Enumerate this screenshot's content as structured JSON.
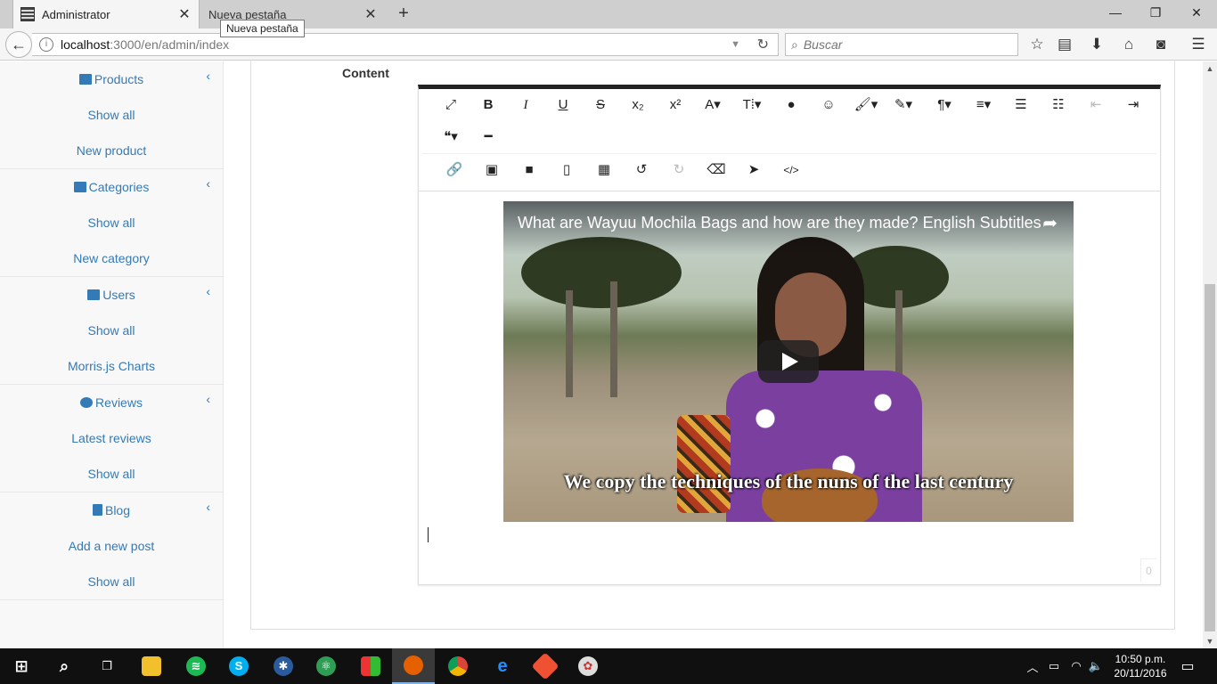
{
  "browser": {
    "tabs": [
      {
        "title": "Administrator",
        "active": true
      },
      {
        "title": "Nueva pestaña",
        "active": false
      }
    ],
    "tooltip": "Nueva pestaña",
    "url_host": "localhost",
    "url_path": ":3000/en/admin/index",
    "search_placeholder": "Buscar"
  },
  "sidebar": {
    "groups": [
      {
        "label": "Products",
        "icon": "archive-icon",
        "items": [
          "Show all",
          "New product"
        ]
      },
      {
        "label": "Categories",
        "icon": "users-icon",
        "items": [
          "Show all",
          "New category"
        ]
      },
      {
        "label": "Users",
        "icon": "users-icon",
        "items": [
          "Show all",
          "Morris.js Charts"
        ]
      },
      {
        "label": "Reviews",
        "icon": "comments-icon",
        "items": [
          "Latest reviews",
          "Show all"
        ]
      },
      {
        "label": "Blog",
        "icon": "file-text-icon",
        "items": [
          "Add a new post",
          "Show all"
        ]
      }
    ]
  },
  "main": {
    "content_label": "Content",
    "video": {
      "title": "What are Wayuu Mochila Bags and how are they made? English Subtitles",
      "subtitle": "We copy the techniques of the nuns of the last century"
    },
    "char_count": "0"
  },
  "toolbar": {
    "row1": [
      {
        "name": "fullscreen-icon",
        "glyph": "⤢"
      },
      {
        "name": "bold-icon",
        "glyph": "B"
      },
      {
        "name": "italic-icon",
        "glyph": "I"
      },
      {
        "name": "underline-icon",
        "glyph": "U"
      },
      {
        "name": "strikethrough-icon",
        "glyph": "S"
      },
      {
        "name": "subscript-icon",
        "glyph": "x₂"
      },
      {
        "name": "superscript-icon",
        "glyph": "x²"
      },
      {
        "name": "font-family-icon",
        "glyph": "A▾"
      },
      {
        "name": "font-size-icon",
        "glyph": "T⁞▾"
      },
      {
        "name": "color-icon",
        "glyph": "●"
      },
      {
        "name": "emoticons-icon",
        "glyph": "☺"
      },
      {
        "name": "paint-brush-icon",
        "glyph": "🖌▾"
      },
      {
        "name": "magic-icon",
        "glyph": "✎▾"
      },
      {
        "name": "paragraph-icon",
        "glyph": "¶▾"
      },
      {
        "name": "align-icon",
        "glyph": "≡▾"
      },
      {
        "name": "ordered-list-icon",
        "glyph": "☰"
      },
      {
        "name": "unordered-list-icon",
        "glyph": "☷"
      },
      {
        "name": "outdent-icon",
        "glyph": "⇤"
      },
      {
        "name": "indent-icon",
        "glyph": "⇥"
      }
    ],
    "row1b": [
      {
        "name": "quote-icon",
        "glyph": "❝▾"
      },
      {
        "name": "horizontal-rule-icon",
        "glyph": "━"
      }
    ],
    "row2": [
      {
        "name": "link-icon",
        "glyph": "🔗"
      },
      {
        "name": "image-icon",
        "glyph": "▣"
      },
      {
        "name": "video-icon",
        "glyph": "■"
      },
      {
        "name": "file-icon",
        "glyph": "▯"
      },
      {
        "name": "table-icon",
        "glyph": "▦"
      },
      {
        "name": "undo-icon",
        "glyph": "↺"
      },
      {
        "name": "redo-icon",
        "glyph": "↻"
      },
      {
        "name": "eraser-icon",
        "glyph": "⌫"
      },
      {
        "name": "select-all-icon",
        "glyph": "➤"
      },
      {
        "name": "code-view-icon",
        "glyph": "</>"
      }
    ]
  },
  "taskbar": {
    "clock_time": "10:50 p.m.",
    "clock_date": "20/11/2016"
  }
}
